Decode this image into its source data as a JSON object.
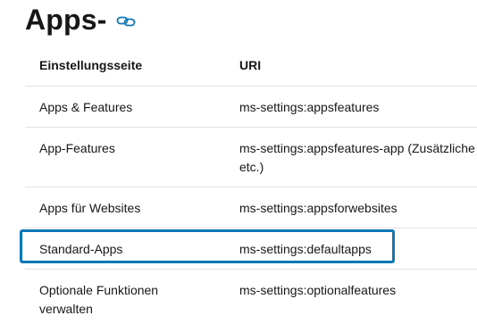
{
  "heading": {
    "title": "Apps-"
  },
  "table": {
    "headers": {
      "col1": "Einstellungsseite",
      "col2": "URI"
    },
    "rows": [
      {
        "page": "Apps & Features",
        "uri": "ms-settings:appsfeatures"
      },
      {
        "page": "App-Features",
        "uri": "ms-settings:appsfeatures-app (Zusätzliche u",
        "uri_cont": "etc.)"
      },
      {
        "page": "Apps für Websites",
        "uri": "ms-settings:appsforwebsites"
      },
      {
        "page": "Standard-Apps",
        "uri": "ms-settings:defaultapps"
      },
      {
        "page": "Optionale Funktionen",
        "page_cont": "verwalten",
        "uri": "ms-settings:optionalfeatures"
      }
    ]
  },
  "highlight": {
    "row_index": 3,
    "color": "#0e77b6"
  },
  "icons": {
    "permalink": "link-icon"
  }
}
